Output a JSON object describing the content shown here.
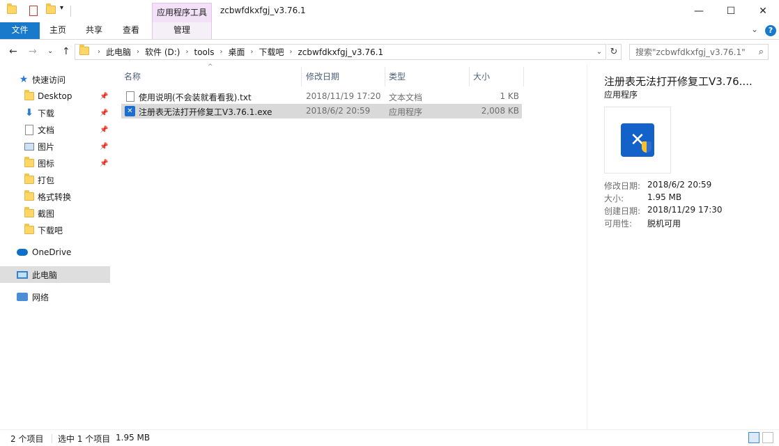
{
  "window": {
    "title": "zcbwfdkxfgj_v3.76.1",
    "context_tab": "应用程序工具",
    "minimize": "—",
    "maximize": "☐",
    "close": "✕"
  },
  "ribbon": {
    "tabs": [
      "文件",
      "主页",
      "共享",
      "查看",
      "管理"
    ],
    "collapse": "⌄",
    "help": "?"
  },
  "address": {
    "back": "←",
    "forward": "→",
    "recent": "⌄",
    "up": "↑",
    "crumbs": [
      "此电脑",
      "软件 (D:)",
      "tools",
      "桌面",
      "下载吧",
      "zcbwfdkxfgj_v3.76.1"
    ],
    "sep": "›",
    "dropdown": "⌄",
    "refresh": "↻"
  },
  "search": {
    "placeholder": "搜索\"zcbwfdkxfgj_v3.76.1\"",
    "icon": "⌕"
  },
  "nav": {
    "quick_access": "快速访问",
    "items": [
      "Desktop",
      "下载",
      "文档",
      "图片",
      "图标",
      "打包",
      "格式转换",
      "截图",
      "下载吧"
    ],
    "pin": "📌",
    "onedrive": "OneDrive",
    "this_pc": "此电脑",
    "network": "网络"
  },
  "columns": {
    "name": "名称",
    "date": "修改日期",
    "type": "类型",
    "size": "大小",
    "sort_arrow": "^"
  },
  "files": [
    {
      "name": "使用说明(不会装就看看我).txt",
      "date": "2018/11/19 17:20",
      "type": "文本文档",
      "size": "1 KB",
      "icon": "text-file-icon"
    },
    {
      "name": "注册表无法打开修复工V3.76.1.exe",
      "date": "2018/6/2 20:59",
      "type": "应用程序",
      "size": "2,008 KB",
      "icon": "exe-app-icon"
    }
  ],
  "preview": {
    "title": "注册表无法打开修复工V3.76....",
    "subtitle": "应用程序",
    "props": [
      {
        "label": "修改日期:",
        "value": "2018/6/2 20:59"
      },
      {
        "label": "大小:",
        "value": "1.95 MB"
      },
      {
        "label": "创建日期:",
        "value": "2018/11/29 17:30"
      },
      {
        "label": "可用性:",
        "value": "脱机可用"
      }
    ]
  },
  "status": {
    "count": "2 个项目",
    "selected": "选中 1 个项目",
    "size": "1.95 MB"
  },
  "colors": {
    "file_tab": "#1979ca",
    "context_tab": "#f3e2f7",
    "selection": "#d9d9d9"
  }
}
